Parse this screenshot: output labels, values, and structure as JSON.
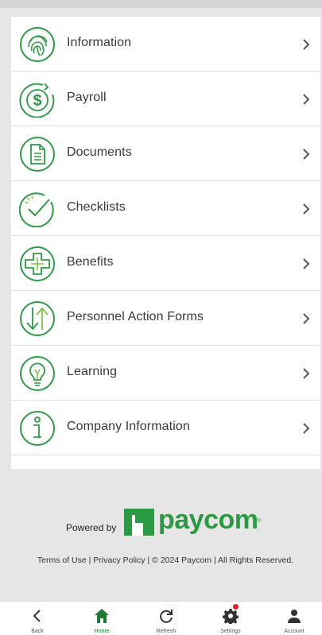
{
  "colors": {
    "brand_green": "#2a9a43",
    "icon_green": "#2f9a47",
    "notification": "#e0202a"
  },
  "menu": {
    "items": [
      {
        "label": "Information",
        "icon": "fingerprint-icon"
      },
      {
        "label": "Payroll",
        "icon": "money-icon"
      },
      {
        "label": "Documents",
        "icon": "document-icon"
      },
      {
        "label": "Checklists",
        "icon": "checklist-icon"
      },
      {
        "label": "Benefits",
        "icon": "benefits-cross-icon"
      },
      {
        "label": "Personnel Action Forms",
        "icon": "up-down-arrows-icon"
      },
      {
        "label": "Learning",
        "icon": "lightbulb-icon"
      },
      {
        "label": "Company Information",
        "icon": "info-icon"
      }
    ]
  },
  "footer": {
    "powered_by": "Powered by",
    "brand": "paycom",
    "brand_mark": "®",
    "legal": "Terms of Use | Privacy Policy | © 2024 Paycom | All Rights Reserved."
  },
  "bottom_nav": {
    "items": [
      {
        "label": "Back",
        "icon": "back-chevron-icon"
      },
      {
        "label": "Home",
        "icon": "home-icon",
        "active": true
      },
      {
        "label": "Refresh",
        "icon": "refresh-icon"
      },
      {
        "label": "Settings",
        "icon": "gear-icon",
        "notification": true
      },
      {
        "label": "Account",
        "icon": "person-icon"
      }
    ]
  }
}
